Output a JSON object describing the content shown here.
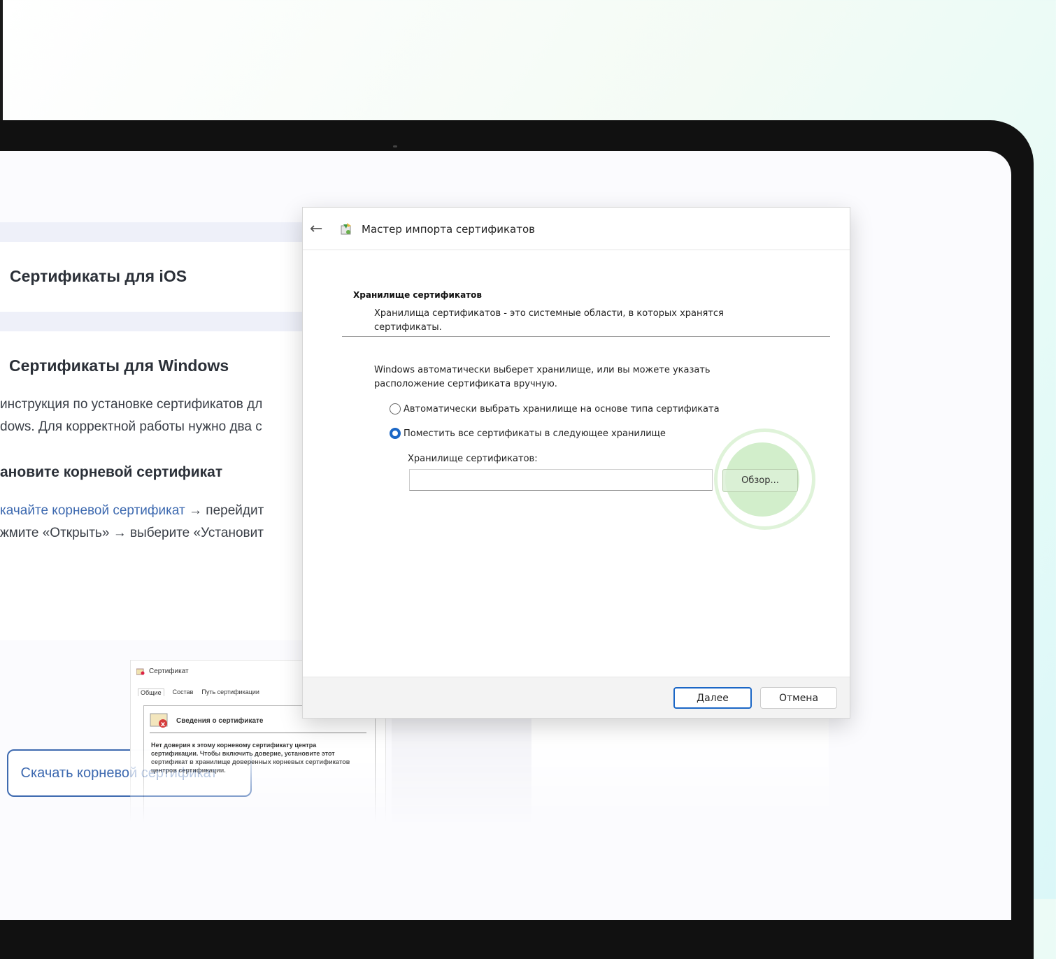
{
  "page": {
    "ios_card": {
      "title": "Сертификаты для iOS"
    },
    "windows_card": {
      "title": "Сертификаты для Windows",
      "line1": "инструкция по установке сертификатов дл",
      "line2": "dows. Для корректной работы нужно два с",
      "step_heading": "ановите корневой сертификат",
      "step_link": "качайте корневой сертификат",
      "step_line1_rest": " → перейдит",
      "step_line2": "жмите «Открыть» → выберите «Установит",
      "download_button": "Скачать корневой сертификат"
    }
  },
  "mini_window": {
    "title": "Сертификат",
    "tabs": [
      "Общие",
      "Состав",
      "Путь сертификации"
    ],
    "heading": "Сведения о сертификате",
    "body": "Нет доверия к этому корневому сертификату центра сертификации. Чтобы включить доверие, установите этот сертификат в хранилище доверенных корневых сертификатов центров сертификации."
  },
  "dialog": {
    "title": "Мастер импорта сертификатов",
    "section_title": "Хранилище сертификатов",
    "section_desc": "Хранилища сертификатов - это системные области, в которых хранятся сертификаты.",
    "intro": "Windows автоматически выберет хранилище, или вы можете указать расположение сертификата вручную.",
    "radio_auto": "Автоматически выбрать хранилище на основе типа сертификата",
    "radio_manual": "Поместить все сертификаты в следующее хранилище",
    "selected_option": "manual",
    "store_label": "Хранилище сертификатов:",
    "store_value": "",
    "browse_button": "Обзор...",
    "next_button": "Далее",
    "cancel_button": "Отмена"
  },
  "colors": {
    "accent_blue": "#3e6ab0",
    "windows_blue": "#1b67c6",
    "highlight_green": "#d2eecb",
    "device_frame": "#111111"
  }
}
